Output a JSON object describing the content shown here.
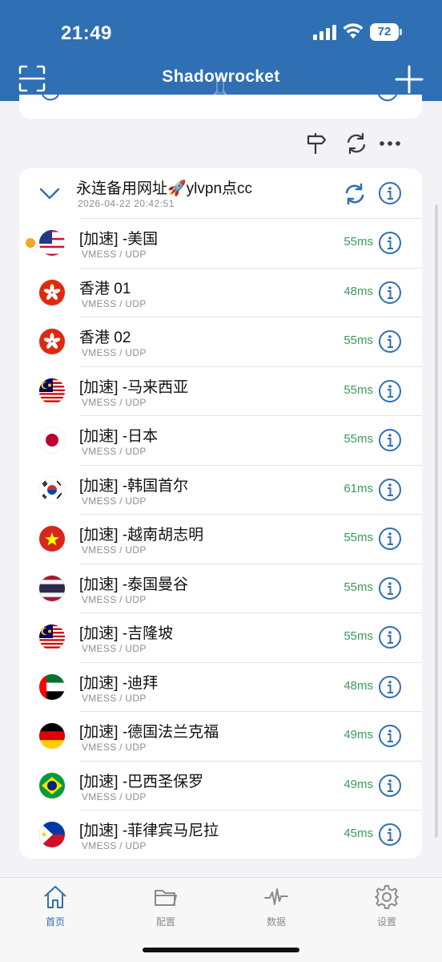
{
  "status": {
    "time": "21:49",
    "battery": "72"
  },
  "nav": {
    "title": "Shadowrocket"
  },
  "group": {
    "name": "永连备用网址🚀ylvpn点cc",
    "date": "2026-04-22 20:42:51"
  },
  "nodes": [
    {
      "name": "[加速] -美国",
      "protocol": "VMESS / UDP",
      "latency": "55ms",
      "flag": "us-flag",
      "selected": true
    },
    {
      "name": "香港 01",
      "protocol": "VMESS / UDP",
      "latency": "48ms",
      "flag": "hk-flag"
    },
    {
      "name": "香港 02",
      "protocol": "VMESS / UDP",
      "latency": "55ms",
      "flag": "hk-flag"
    },
    {
      "name": "[加速] -马来西亚",
      "protocol": "VMESS / UDP",
      "latency": "55ms",
      "flag": "my-flag"
    },
    {
      "name": "[加速] -日本",
      "protocol": "VMESS / UDP",
      "latency": "55ms",
      "flag": "jp-flag"
    },
    {
      "name": "[加速] -韩国首尔",
      "protocol": "VMESS / UDP",
      "latency": "61ms",
      "flag": "kr-flag"
    },
    {
      "name": "[加速] -越南胡志明",
      "protocol": "VMESS / UDP",
      "latency": "55ms",
      "flag": "vn-flag"
    },
    {
      "name": "[加速] -泰国曼谷",
      "protocol": "VMESS / UDP",
      "latency": "55ms",
      "flag": "th-flag"
    },
    {
      "name": "[加速] -吉隆坡",
      "protocol": "VMESS / UDP",
      "latency": "55ms",
      "flag": "my-flag"
    },
    {
      "name": "[加速] -迪拜",
      "protocol": "VMESS / UDP",
      "latency": "48ms",
      "flag": "ae-flag"
    },
    {
      "name": "[加速] -德国法兰克福",
      "protocol": "VMESS / UDP",
      "latency": "49ms",
      "flag": "de-flag"
    },
    {
      "name": "[加速] -巴西圣保罗",
      "protocol": "VMESS / UDP",
      "latency": "49ms",
      "flag": "br-flag"
    },
    {
      "name": "[加速] -菲律宾马尼拉",
      "protocol": "VMESS / UDP",
      "latency": "45ms",
      "flag": "ph-flag"
    }
  ],
  "tabs": [
    {
      "label": "首页",
      "icon": "home-icon",
      "active": true
    },
    {
      "label": "配置",
      "icon": "folder-icon"
    },
    {
      "label": "数据",
      "icon": "activity-icon"
    },
    {
      "label": "设置",
      "icon": "gear-icon"
    }
  ],
  "colors": {
    "accent": "#2f6fb3",
    "latency": "#3a9b5a",
    "selected": "#f5a623"
  }
}
